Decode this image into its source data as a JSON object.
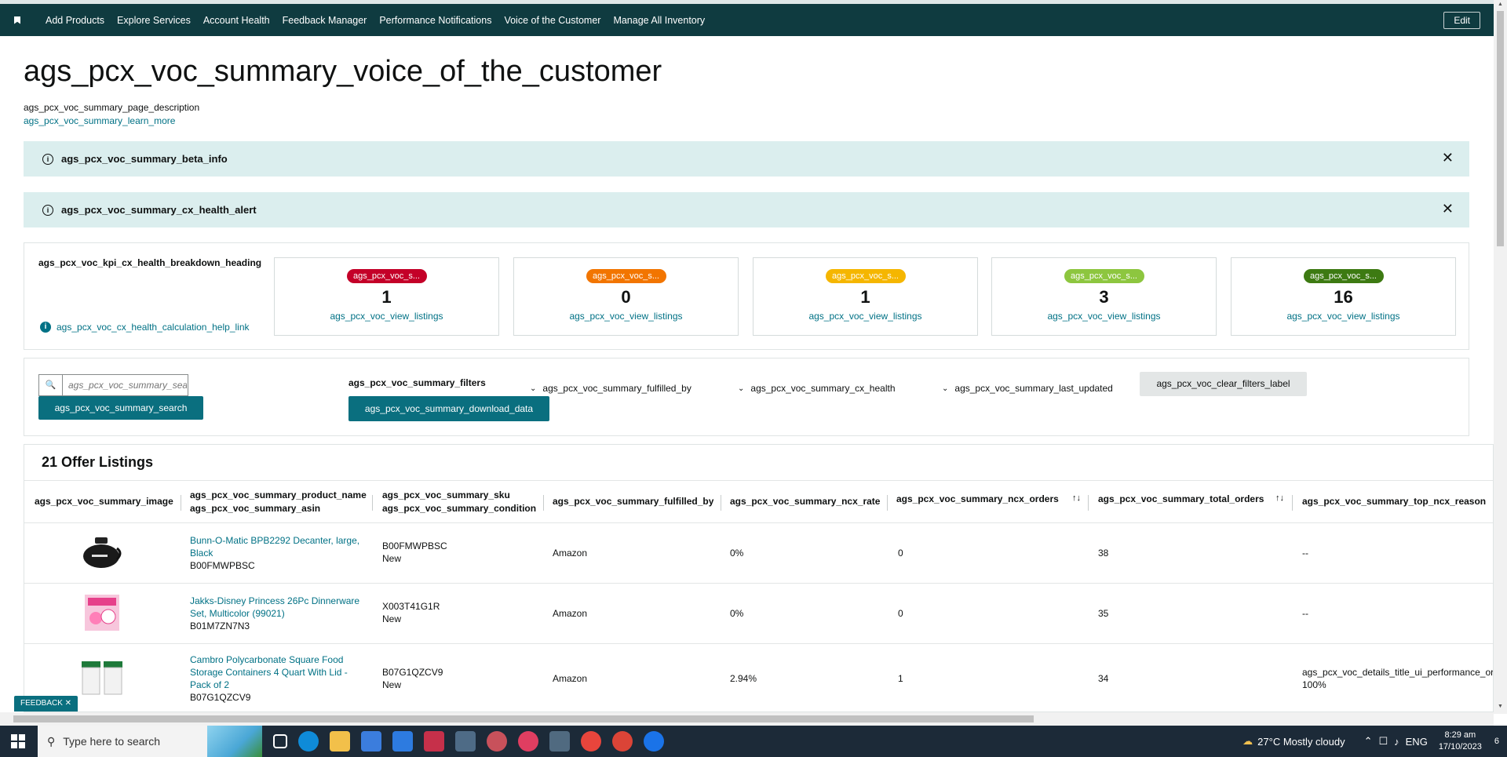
{
  "nav": {
    "items": [
      "Add Products",
      "Explore Services",
      "Account Health",
      "Feedback Manager",
      "Performance Notifications",
      "Voice of the Customer",
      "Manage All Inventory"
    ],
    "edit_label": "Edit"
  },
  "page": {
    "title": "ags_pcx_voc_summary_voice_of_the_customer",
    "description": "ags_pcx_voc_summary_page_description",
    "learn_more": "ags_pcx_voc_summary_learn_more"
  },
  "alerts": [
    {
      "text": "ags_pcx_voc_summary_beta_info"
    },
    {
      "text": "ags_pcx_voc_summary_cx_health_alert"
    }
  ],
  "kpi": {
    "heading": "ags_pcx_voc_kpi_cx_health_breakdown_heading",
    "help_link": "ags_pcx_voc_cx_health_calculation_help_link",
    "cards": [
      {
        "pill": "ags_pcx_voc_s...",
        "count": "1",
        "link": "ags_pcx_voc_view_listings",
        "color": "#c40028"
      },
      {
        "pill": "ags_pcx_voc_s...",
        "count": "0",
        "link": "ags_pcx_voc_view_listings",
        "color": "#f27500"
      },
      {
        "pill": "ags_pcx_voc_s...",
        "count": "1",
        "link": "ags_pcx_voc_view_listings",
        "color": "#f5b600"
      },
      {
        "pill": "ags_pcx_voc_s...",
        "count": "3",
        "link": "ags_pcx_voc_view_listings",
        "color": "#8dc63f"
      },
      {
        "pill": "ags_pcx_voc_s...",
        "count": "16",
        "link": "ags_pcx_voc_view_listings",
        "color": "#3d7a12"
      }
    ]
  },
  "filters": {
    "search_placeholder": "ags_pcx_voc_summary_search_placeholder",
    "search_button": "ags_pcx_voc_summary_search",
    "filters_label": "ags_pcx_voc_summary_filters",
    "download": "ags_pcx_voc_summary_download_data",
    "fulfilled_by": "ags_pcx_voc_summary_fulfilled_by",
    "cx_health": "ags_pcx_voc_summary_cx_health",
    "last_updated": "ags_pcx_voc_summary_last_updated",
    "clear": "ags_pcx_voc_clear_filters_label"
  },
  "table": {
    "title": "21 Offer Listings",
    "headers": {
      "image": "ags_pcx_voc_summary_image",
      "product_name": "ags_pcx_voc_summary_product_name",
      "asin": "ags_pcx_voc_summary_asin",
      "sku": "ags_pcx_voc_summary_sku",
      "condition": "ags_pcx_voc_summary_condition",
      "fulfilled_by": "ags_pcx_voc_summary_fulfilled_by",
      "ncx_rate": "ags_pcx_voc_summary_ncx_rate",
      "ncx_orders": "ags_pcx_voc_summary_ncx_orders",
      "total_orders": "ags_pcx_voc_summary_total_orders",
      "top_reason": "ags_pcx_voc_summary_top_ncx_reason"
    },
    "rows": [
      {
        "name_line1": "Bunn-O-Matic BPB2292 Decanter, large,",
        "name_line2": "Black",
        "name_line3": "",
        "asin": "B00FMWPBSC",
        "sku": "B00FMWPBSC",
        "condition": "New",
        "fulfilled_by": "Amazon",
        "ncx_rate": "0%",
        "ncx_orders": "0",
        "total_orders": "38",
        "reason": "--",
        "reason2": ""
      },
      {
        "name_line1": "Jakks-Disney Princess 26Pc Dinnerware",
        "name_line2": "Set, Multicolor (99021)",
        "name_line3": "",
        "asin": "B01M7ZN7N3",
        "sku": "X003T41G1R",
        "condition": "New",
        "fulfilled_by": "Amazon",
        "ncx_rate": "0%",
        "ncx_orders": "0",
        "total_orders": "35",
        "reason": "--",
        "reason2": ""
      },
      {
        "name_line1": "Cambro Polycarbonate Square Food",
        "name_line2": "Storage Containers 4 Quart With Lid -",
        "name_line3": "Pack of 2",
        "asin": "B07G1QZCV9",
        "sku": "B07G1QZCV9",
        "condition": "New",
        "fulfilled_by": "Amazon",
        "ncx_rate": "2.94%",
        "ncx_orders": "1",
        "total_orders": "34",
        "reason": "ags_pcx_voc_details_title_ui_performance_or_",
        "reason2": "100%"
      }
    ]
  },
  "feedback_tab": "FEEDBACK ✕",
  "taskbar": {
    "search_placeholder": "Type here to search",
    "weather": "27°C  Mostly cloudy",
    "lang": "ENG",
    "time": "8:29 am",
    "date": "17/10/2023",
    "notif_count": "6"
  }
}
